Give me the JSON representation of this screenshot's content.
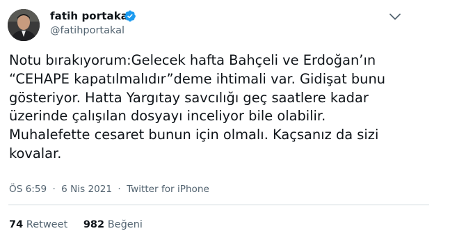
{
  "author": {
    "display_name": "fatih portakal",
    "handle": "@fatihportakal",
    "verified": true
  },
  "tweet": {
    "text": "Notu bırakıyorum:Gelecek hafta Bahçeli ve Erdoğan’ın\n“CEHAPE kapatılmalıdır”deme ihtimali var. Gidişat bunu\ngösteriyor. Hatta Yargıtay savcılığı geç saatlere kadar\nüzerinde çalışılan dosyayı inceliyor bile olabilir.\nMuhalefette cesaret bunun için olmalı. Kaçsanız da sizi\nkovalar.",
    "time": "ÖS 6:59",
    "separator": "·",
    "date": "6 Nis 2021",
    "source": "Twitter for iPhone"
  },
  "stats": {
    "retweets_count": "74",
    "retweets_label": "Retweet",
    "likes_count": "982",
    "likes_label": "Beğeni"
  },
  "icons": {
    "verified": "verified-badge-icon",
    "menu": "chevron-down-icon"
  },
  "colors": {
    "verified_blue": "#1d9bf0",
    "secondary_text": "#536471",
    "primary_text": "#0f1419",
    "divider": "#cfd9de"
  }
}
